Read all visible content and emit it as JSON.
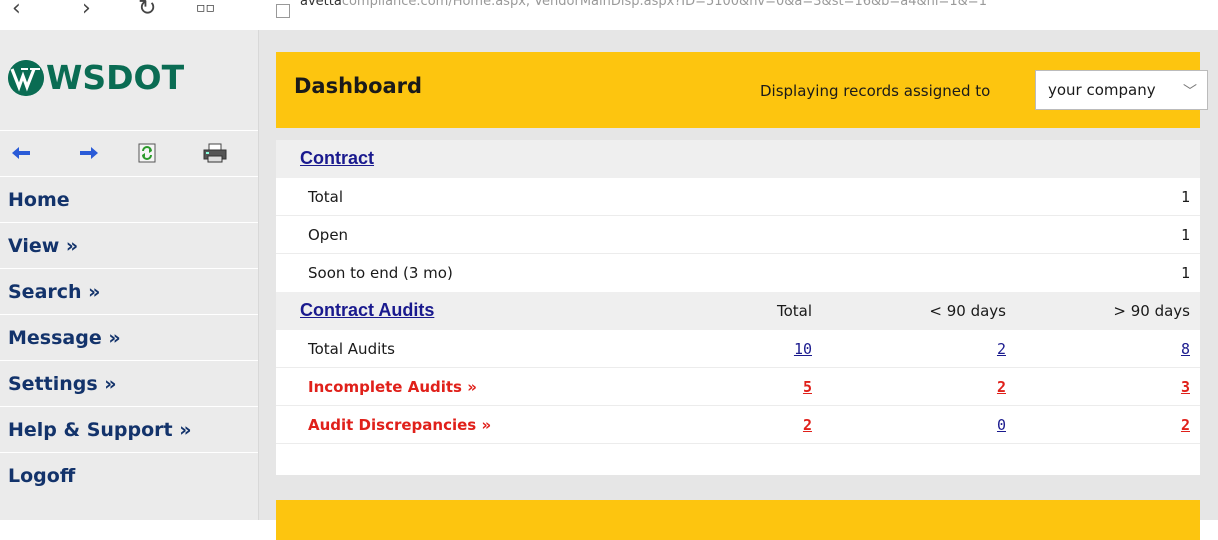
{
  "browser": {
    "back_glyph": "‹",
    "forward_glyph": "›",
    "reload_glyph": "↻",
    "url_domain": "avetta",
    "url_rest": "compliance.com/Home.aspx, VendorMainDisp.aspx?ID=5100&nv=0&a=3&st=16&b=a4&nl=1&=1"
  },
  "sidebar": {
    "logo_text": "WSDOT",
    "logo_color": "#0a6c53",
    "toolbar": [
      {
        "icon": "back-arrow-icon"
      },
      {
        "icon": "forward-arrow-icon"
      },
      {
        "icon": "refresh-icon"
      },
      {
        "icon": "print-icon"
      }
    ],
    "menu": [
      {
        "label": "Home"
      },
      {
        "label": "View »"
      },
      {
        "label": "Search »"
      },
      {
        "label": "Message »"
      },
      {
        "label": "Settings »"
      },
      {
        "label": "Help & Support »"
      },
      {
        "label": "Logoff"
      }
    ]
  },
  "header": {
    "title": "Dashboard",
    "filter_label": "Displaying records assigned to",
    "filter_value": "your company",
    "accent_color": "#fdc50f"
  },
  "contract": {
    "title": "Contract",
    "rows": [
      {
        "label": "Total",
        "value": "1"
      },
      {
        "label": "Open",
        "value": "1"
      },
      {
        "label": "Soon to end (3 mo)",
        "value": "1"
      }
    ]
  },
  "audits": {
    "title": "Contract Audits",
    "columns": [
      "Total",
      "< 90 days",
      "> 90 days"
    ],
    "rows": [
      {
        "label": "Total Audits",
        "total": "10",
        "under90": "2",
        "over90": "8",
        "alert": false
      },
      {
        "label": "Incomplete Audits »",
        "total": "5",
        "under90": "2",
        "over90": "3",
        "alert": true
      },
      {
        "label": "Audit Discrepancies »",
        "total": "2",
        "under90": "0",
        "over90": "2",
        "alert": true
      }
    ]
  },
  "colors": {
    "link": "#1a1a8e",
    "alert": "#e0201a",
    "menu_text": "#13336b"
  }
}
